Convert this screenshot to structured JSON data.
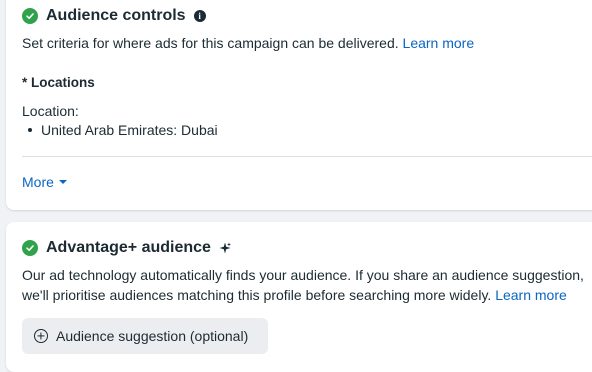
{
  "audience_controls": {
    "title": "Audience controls",
    "description": "Set criteria for where ads for this campaign can be delivered.",
    "learn_more": "Learn more",
    "locations_required_marker": "* ",
    "locations_label": "Locations",
    "location_prefix": "Location:",
    "locations": [
      "United Arab Emirates: Dubai"
    ],
    "more_label": "More"
  },
  "advantage_audience": {
    "title": "Advantage+ audience",
    "description_line1": "Our ad technology automatically finds your audience. If you share an audience suggestion,",
    "description_line2": "we'll prioritise audiences matching this profile before searching more widely.",
    "learn_more": "Learn more",
    "suggestion_button": "Audience suggestion (optional)"
  },
  "colors": {
    "check_green": "#31a24c",
    "link_blue": "#0a66c2",
    "text": "#1c2b33"
  },
  "icons": {
    "status": "check-circle-icon",
    "info": "info-icon",
    "sparkle": "sparkle-icon",
    "caret": "caret-down-icon",
    "plus": "plus-circle-icon"
  }
}
